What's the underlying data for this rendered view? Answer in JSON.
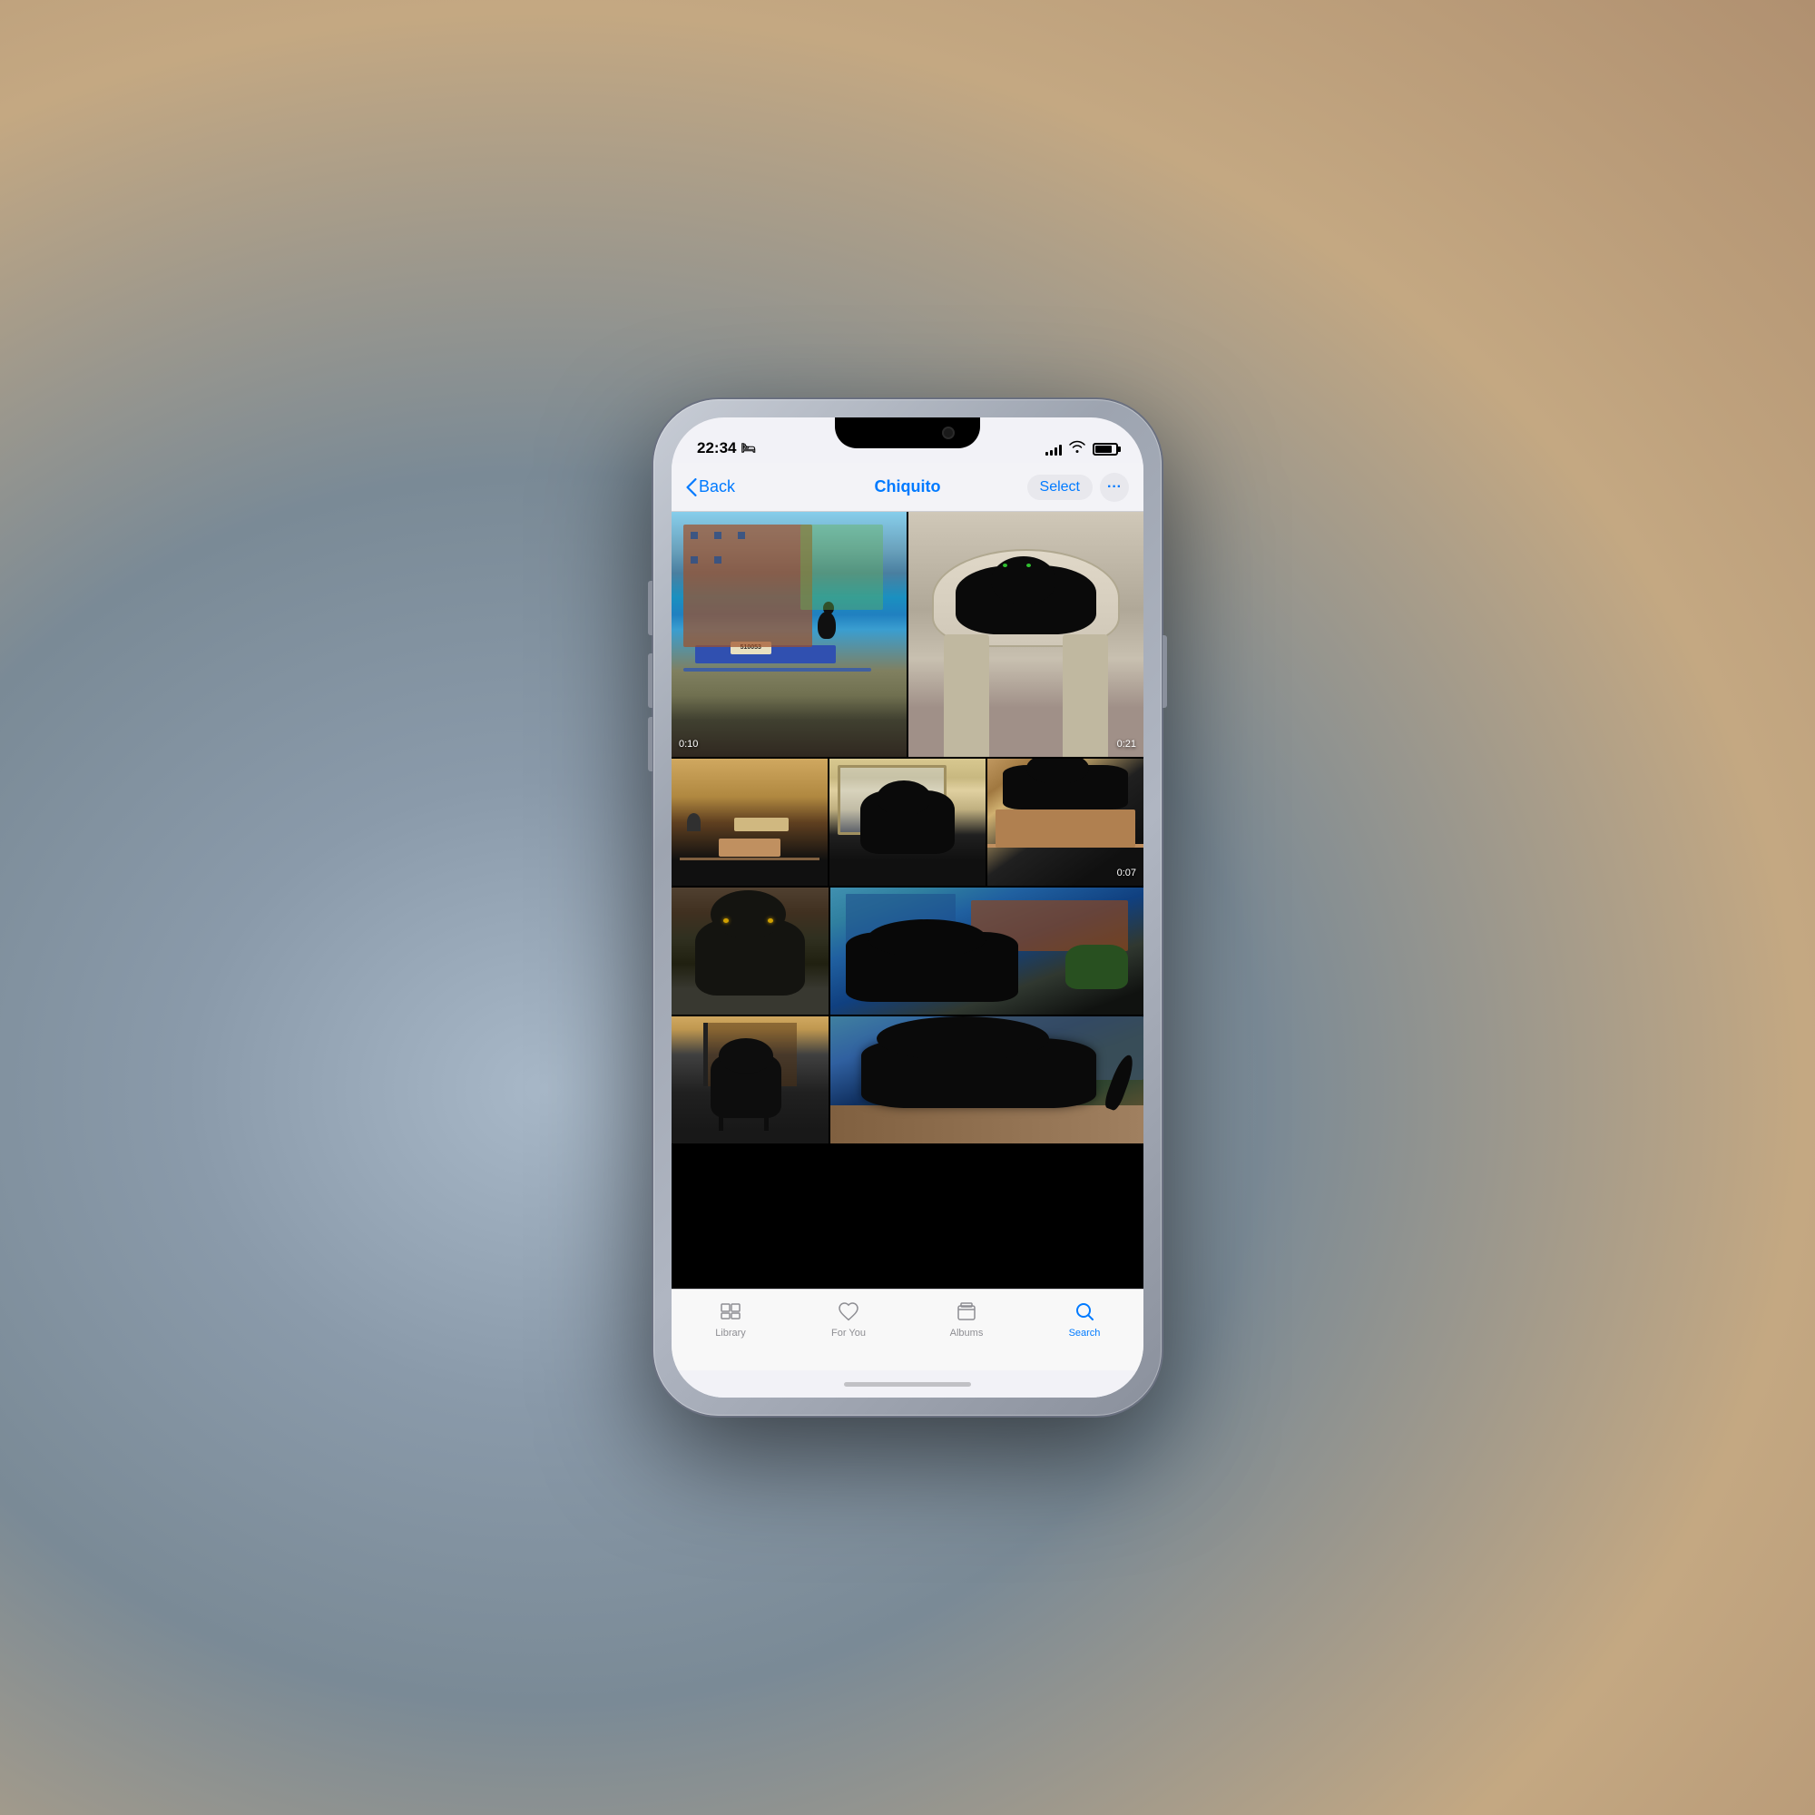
{
  "device": {
    "status_bar": {
      "time": "22:34",
      "sleep_icon": "🛏",
      "signal_bars": [
        4,
        6,
        8,
        10,
        12
      ],
      "wifi": true,
      "battery_percent": 80
    },
    "notch": true
  },
  "nav": {
    "back_label": "Back",
    "title": "Chiquito",
    "select_label": "Select",
    "more_label": "···"
  },
  "photos": {
    "grid": [
      {
        "row": 0,
        "cells": [
          {
            "id": "p1",
            "scene": "boat",
            "video_duration": "0:10",
            "colspan": 1
          },
          {
            "id": "p2",
            "scene": "cat_hammock",
            "video_duration": "0:21",
            "colspan": 1
          }
        ]
      },
      {
        "row": 1,
        "cells": [
          {
            "id": "p3",
            "scene": "desk",
            "video_duration": null
          },
          {
            "id": "p4",
            "scene": "indoor_cat",
            "video_duration": null
          },
          {
            "id": "p5",
            "scene": "closeup",
            "video_duration": "0:07"
          }
        ]
      },
      {
        "row": 2,
        "cells": [
          {
            "id": "p6",
            "scene": "closeup2",
            "video_duration": null
          },
          {
            "id": "p7_p8",
            "scene": "boat2",
            "video_duration": null,
            "colspan": 2
          }
        ]
      },
      {
        "row": 3,
        "cells": [
          {
            "id": "p9",
            "scene": "indoor2",
            "video_duration": null
          }
        ]
      }
    ]
  },
  "tab_bar": {
    "items": [
      {
        "id": "library",
        "label": "Library",
        "active": false,
        "icon": "library-icon"
      },
      {
        "id": "for-you",
        "label": "For You",
        "active": false,
        "icon": "for-you-icon"
      },
      {
        "id": "albums",
        "label": "Albums",
        "active": false,
        "icon": "albums-icon"
      },
      {
        "id": "search",
        "label": "Search",
        "active": true,
        "icon": "search-icon"
      }
    ]
  }
}
